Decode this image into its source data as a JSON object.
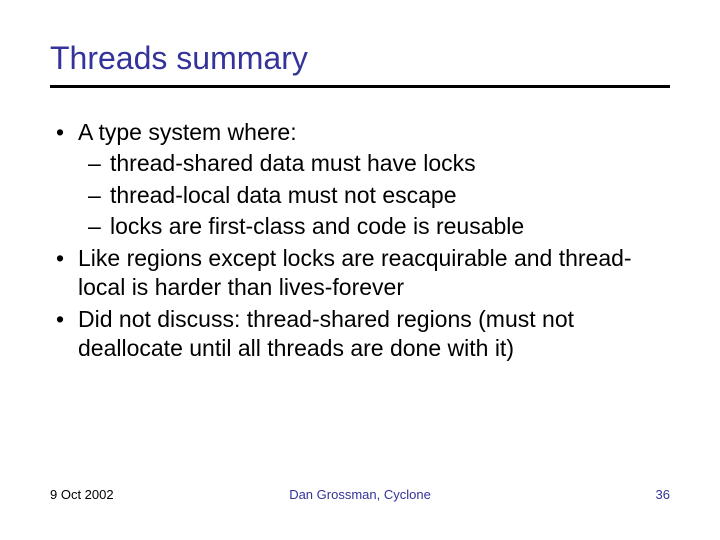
{
  "title": "Threads summary",
  "bullets": {
    "b1": "A type system where:",
    "s1": "thread-shared data must have locks",
    "s2": "thread-local data must not escape",
    "s3": "locks are first-class and code is reusable",
    "b2": "Like regions except locks are reacquirable and thread-local is harder than lives-forever",
    "b3": "Did not discuss: thread-shared regions (must not deallocate until all threads are done with it)"
  },
  "footer": {
    "date": "9 Oct 2002",
    "author": "Dan Grossman, Cyclone",
    "page": "36"
  }
}
